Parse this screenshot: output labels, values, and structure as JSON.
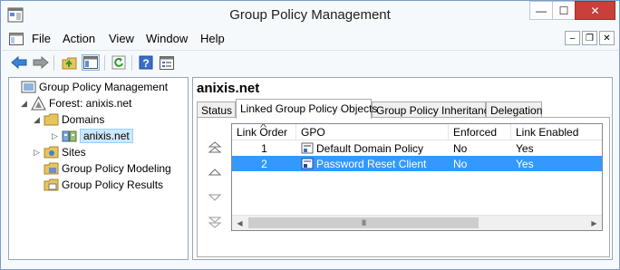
{
  "window": {
    "title": "Group Policy Management",
    "minimize_glyph": "—",
    "maximize_glyph": "☐",
    "close_glyph": "✕"
  },
  "menubar": {
    "items": [
      "File",
      "Action",
      "View",
      "Window",
      "Help"
    ],
    "mdi_minimize": "–",
    "mdi_restore": "❐",
    "mdi_close": "✕"
  },
  "toolbar": {
    "buttons": [
      "back-icon",
      "forward-icon",
      "up-folder-icon",
      "show-hide-console-tree-icon",
      "refresh-icon",
      "help-icon",
      "properties-icon"
    ]
  },
  "tree": {
    "items": [
      {
        "label": "Group Policy Management",
        "icon": "gpm-root-icon",
        "expander": ""
      },
      {
        "label": "Forest: anixis.net",
        "icon": "forest-icon",
        "expander": "◢"
      },
      {
        "label": "Domains",
        "icon": "folder-icon",
        "expander": "◢"
      },
      {
        "label": "anixis.net",
        "icon": "domain-icon",
        "expander": "▷"
      },
      {
        "label": "Sites",
        "icon": "sites-icon",
        "expander": "▷"
      },
      {
        "label": "Group Policy Modeling",
        "icon": "gp-modeling-icon",
        "expander": ""
      },
      {
        "label": "Group Policy Results",
        "icon": "gp-results-icon",
        "expander": ""
      }
    ]
  },
  "details": {
    "title": "anixis.net",
    "tabs": [
      {
        "label": "Status",
        "active": false
      },
      {
        "label": "Linked Group Policy Objects",
        "active": true
      },
      {
        "label": "Group Policy Inheritance",
        "active": false
      },
      {
        "label": "Delegation",
        "active": false
      }
    ],
    "columns": [
      "Link Order",
      "GPO",
      "Enforced",
      "Link Enabled"
    ],
    "rows": [
      {
        "order": "1",
        "gpo": "Default Domain Policy",
        "enforced": "No",
        "enabled": "Yes",
        "selected": false
      },
      {
        "order": "2",
        "gpo": "Password Reset Client",
        "enforced": "No",
        "enabled": "Yes",
        "selected": true
      }
    ],
    "scroll_thumb_grip": "III"
  },
  "colors": {
    "selection": "#3399ff",
    "tree_selection": "#cce8ff",
    "close_button": "#c7403a",
    "frame": "#7a9cc8"
  }
}
